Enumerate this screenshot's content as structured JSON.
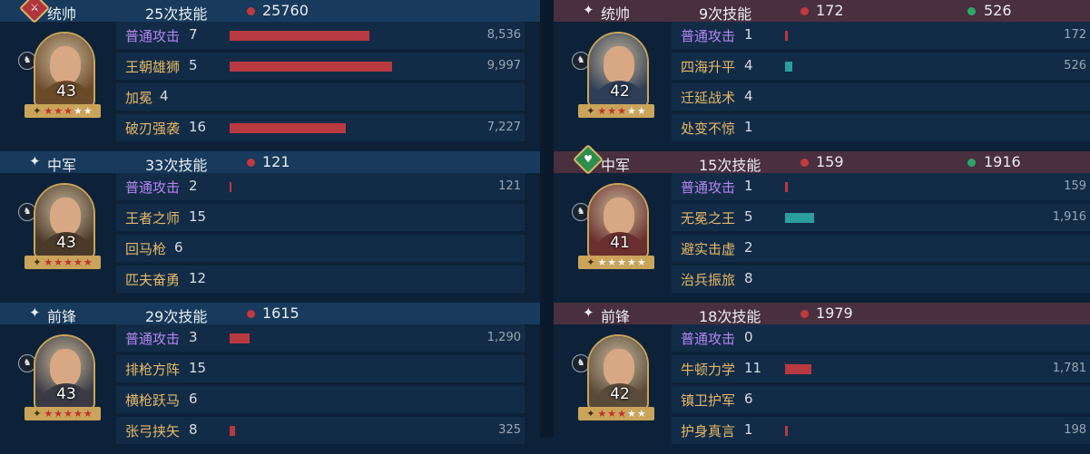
{
  "left": [
    {
      "role": "统帅",
      "casts": "25次技能",
      "damage": "25760",
      "heal": "",
      "badge": "red",
      "level": "43",
      "red_stars": 3,
      "white_stars": 2,
      "skills": [
        {
          "name": "普通攻击",
          "count": "7",
          "type": "basic",
          "fill": 0.48,
          "value": "8,536",
          "bar": "red"
        },
        {
          "name": "王朝雄狮",
          "count": "5",
          "type": "skill",
          "fill": 0.56,
          "value": "9,997",
          "bar": "red"
        },
        {
          "name": "加冕",
          "count": "4",
          "type": "skill",
          "fill": 0,
          "value": "",
          "bar": "red"
        },
        {
          "name": "破刃强袭",
          "count": "16",
          "type": "skill",
          "fill": 0.4,
          "value": "7,227",
          "bar": "red"
        }
      ]
    },
    {
      "role": "中军",
      "casts": "33次技能",
      "damage": "121",
      "heal": "",
      "badge": "star",
      "level": "43",
      "red_stars": 5,
      "white_stars": 0,
      "skills": [
        {
          "name": "普通攻击",
          "count": "2",
          "type": "basic",
          "fill": 0.006,
          "value": "121",
          "bar": "red"
        },
        {
          "name": "王者之师",
          "count": "15",
          "type": "skill",
          "fill": 0,
          "value": "",
          "bar": "red"
        },
        {
          "name": "回马枪",
          "count": "6",
          "type": "skill",
          "fill": 0,
          "value": "",
          "bar": "red"
        },
        {
          "name": "匹夫奋勇",
          "count": "12",
          "type": "skill",
          "fill": 0,
          "value": "",
          "bar": "red"
        }
      ]
    },
    {
      "role": "前锋",
      "casts": "29次技能",
      "damage": "1615",
      "heal": "",
      "badge": "star",
      "level": "43",
      "red_stars": 5,
      "white_stars": 0,
      "skills": [
        {
          "name": "普通攻击",
          "count": "3",
          "type": "basic",
          "fill": 0.07,
          "value": "1,290",
          "bar": "red"
        },
        {
          "name": "排枪方阵",
          "count": "15",
          "type": "skill",
          "fill": 0,
          "value": "",
          "bar": "red"
        },
        {
          "name": "横枪跃马",
          "count": "6",
          "type": "skill",
          "fill": 0,
          "value": "",
          "bar": "red"
        },
        {
          "name": "张弓挟矢",
          "count": "8",
          "type": "skill",
          "fill": 0.018,
          "value": "325",
          "bar": "red"
        }
      ]
    }
  ],
  "right": [
    {
      "role": "统帅",
      "casts": "9次技能",
      "damage": "172",
      "heal": "526",
      "badge": "star",
      "level": "42",
      "red_stars": 3,
      "white_stars": 2,
      "skills": [
        {
          "name": "普通攻击",
          "count": "1",
          "type": "basic",
          "fill": 0.01,
          "value": "172",
          "bar": "red"
        },
        {
          "name": "四海升平",
          "count": "4",
          "type": "skill",
          "fill": 0.026,
          "value": "526",
          "bar": "teal"
        },
        {
          "name": "迁延战术",
          "count": "4",
          "type": "skill",
          "fill": 0,
          "value": "",
          "bar": "red"
        },
        {
          "name": "处变不惊",
          "count": "1",
          "type": "skill",
          "fill": 0,
          "value": "",
          "bar": "red"
        }
      ]
    },
    {
      "role": "中军",
      "casts": "15次技能",
      "damage": "159",
      "heal": "1916",
      "badge": "green",
      "level": "41",
      "red_stars": 0,
      "white_stars": 5,
      "skills": [
        {
          "name": "普通攻击",
          "count": "1",
          "type": "basic",
          "fill": 0.01,
          "value": "159",
          "bar": "red"
        },
        {
          "name": "无冕之王",
          "count": "5",
          "type": "skill",
          "fill": 0.1,
          "value": "1,916",
          "bar": "teal"
        },
        {
          "name": "避实击虚",
          "count": "2",
          "type": "skill",
          "fill": 0,
          "value": "",
          "bar": "red"
        },
        {
          "name": "治兵振旅",
          "count": "8",
          "type": "skill",
          "fill": 0,
          "value": "",
          "bar": "red"
        }
      ]
    },
    {
      "role": "前锋",
      "casts": "18次技能",
      "damage": "1979",
      "heal": "",
      "badge": "star",
      "level": "42",
      "red_stars": 3,
      "white_stars": 2,
      "skills": [
        {
          "name": "普通攻击",
          "count": "0",
          "type": "basic",
          "fill": 0,
          "value": "",
          "bar": "red"
        },
        {
          "name": "牛顿力学",
          "count": "11",
          "type": "skill",
          "fill": 0.09,
          "value": "1,781",
          "bar": "red"
        },
        {
          "name": "镇卫护军",
          "count": "6",
          "type": "skill",
          "fill": 0,
          "value": "",
          "bar": "red"
        },
        {
          "name": "护身真言",
          "count": "1",
          "type": "skill",
          "fill": 0.01,
          "value": "198",
          "bar": "red"
        }
      ]
    }
  ],
  "colors": {
    "portraits": [
      "#6b4a2a",
      "#4a3a2a",
      "#3a3a44",
      "#2e3e56",
      "#6a2f2f",
      "#5a4a3a"
    ]
  }
}
